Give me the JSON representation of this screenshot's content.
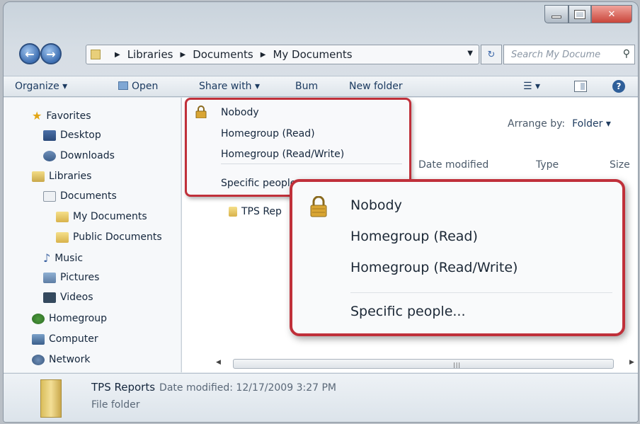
{
  "window": {
    "caption_buttons": [
      "minimize",
      "maximize",
      "close"
    ]
  },
  "address": {
    "crumbs": [
      "Libraries",
      "Documents",
      "My Documents"
    ],
    "search_placeholder": "Search My Docume"
  },
  "toolbar": {
    "organize": "Organize ▾",
    "open": "Open",
    "share_with": "Share with ▾",
    "burn": "Bum",
    "new_folder": "New folder"
  },
  "nav": {
    "favorites": "Favorites",
    "desktop": "Desktop",
    "downloads": "Downloads",
    "libraries": "Libraries",
    "documents": "Documents",
    "my_documents": "My Documents",
    "public_documents": "Public Documents",
    "music": "Music",
    "pictures": "Pictures",
    "videos": "Videos",
    "homegroup": "Homegroup",
    "computer": "Computer",
    "network": "Network"
  },
  "content": {
    "arrange_by_label": "Arrange by:",
    "arrange_by_value": "Folder ▾",
    "columns": {
      "date_modified": "Date modified",
      "type": "Type",
      "size": "Size"
    },
    "file_name_partial": "TPS Rep"
  },
  "details": {
    "name": "TPS Reports",
    "date_modified": "Date modified: 12/17/2009 3:27 PM",
    "type": "File folder"
  },
  "share_menu": {
    "items": [
      "Nobody",
      "Homegroup (Read)",
      "Homegroup (Read/Write)",
      "Specific people..."
    ],
    "small_last": "Specific people"
  },
  "colors": {
    "highlight_border": "#c0303a",
    "lock": "#d9a533"
  }
}
